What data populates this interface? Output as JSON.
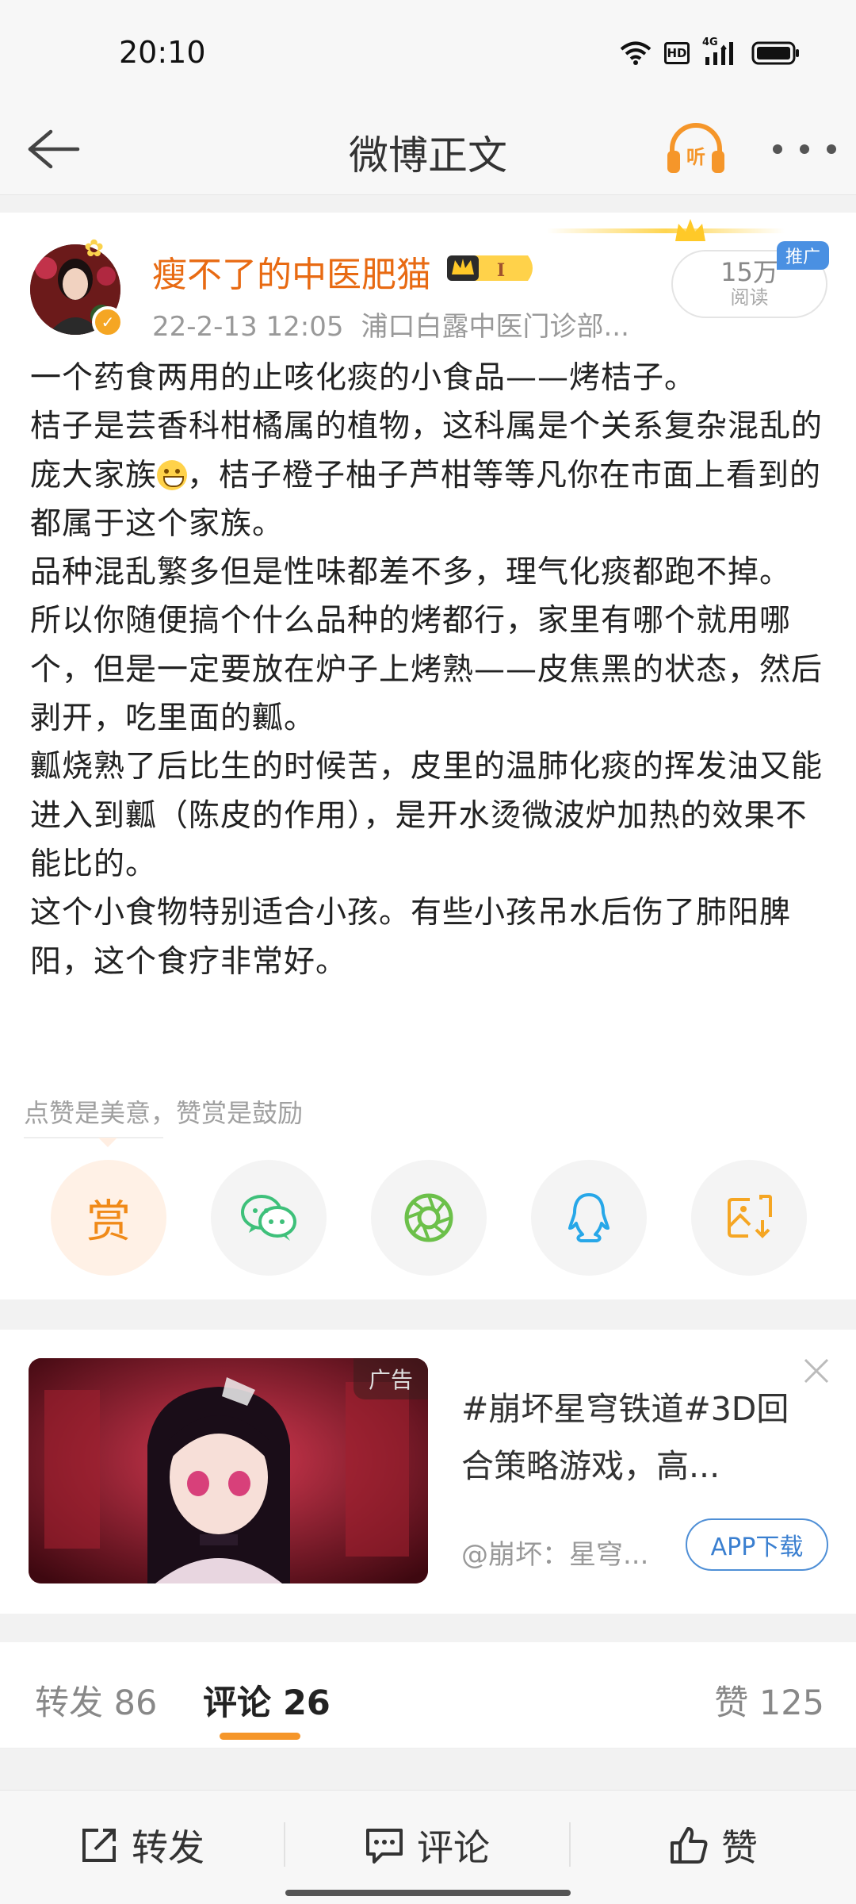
{
  "status_bar": {
    "time": "20:10",
    "hd_label": "HD",
    "network_label": "4G"
  },
  "header": {
    "title": "微博正文"
  },
  "post": {
    "author": {
      "name": "瘦不了的中医肥猫",
      "vip_level": "I"
    },
    "date": "22-2-13 12:05",
    "source": "浦口白露中医门诊部...",
    "read_count": "15万",
    "read_label": "阅读",
    "promo_tag": "推广",
    "body": {
      "p1": "一个药食两用的止咳化痰的小食品——烤桔子。",
      "p2_before": "桔子是芸香科柑橘属的植物，这科属是个关系复杂混乱的庞大家族",
      "p2_after": "，桔子橙子柚子芦柑等等凡你在市面上看到的都属于这个家族。",
      "p3": "品种混乱繁多但是性味都差不多，理气化痰都跑不掉。",
      "p4": "所以你随便搞个什么品种的烤都行，家里有哪个就用哪个，但是一定要放在炉子上烤熟——皮焦黑的状态，然后剥开，吃里面的瓤。",
      "p5": "瓤烧熟了后比生的时候苦，皮里的温肺化痰的挥发油又能进入到瓤（陈皮的作用），是开水烫微波炉加热的效果不能比的。",
      "p6": "这个小食物特别适合小孩。有些小孩吊水后伤了肺阳脾阳，这个食疗非常好。"
    },
    "reward_hint": "点赞是美意，赞赏是鼓励",
    "reward_glyph": "赏",
    "share_icons": [
      "reward-icon",
      "wechat-icon",
      "moments-icon",
      "qq-icon",
      "save-image-icon"
    ]
  },
  "ad": {
    "tag": "广告",
    "title": "#崩坏星穹铁道#3D回合策略游戏，高...",
    "source": "@崩坏：星穹...",
    "download_label": "APP下载"
  },
  "tabs": [
    {
      "label": "转发",
      "count": "86"
    },
    {
      "label": "评论",
      "count": "26"
    },
    {
      "label": "赞",
      "count": "125"
    }
  ],
  "bottom_bar": {
    "repost": "转发",
    "comment": "评论",
    "like": "赞"
  },
  "colors": {
    "accent": "#f5962a",
    "username": "#e86a12",
    "link_blue": "#3a7fd0"
  }
}
